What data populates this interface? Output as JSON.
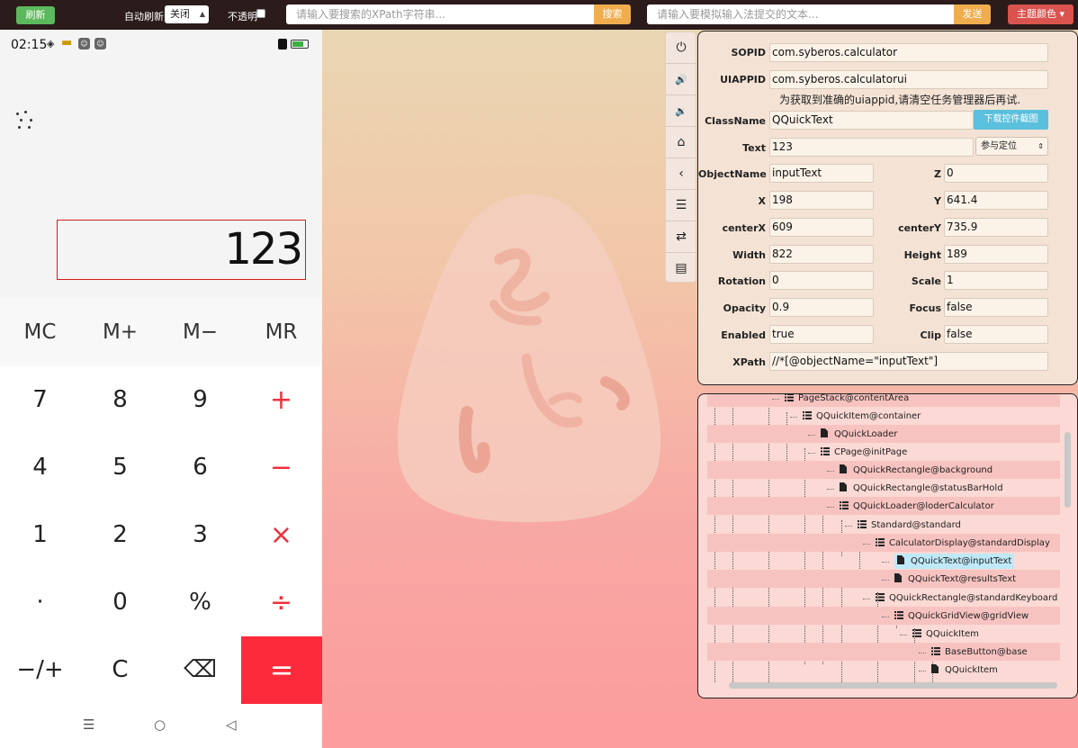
{
  "toolbar": {
    "refresh_label": "刷新",
    "auto_refresh_label": "自动刷新:",
    "auto_refresh_value": "关闭",
    "opaque_label": "不透明",
    "xpath_placeholder": "请输入要搜索的XPath字符串...",
    "search_label": "搜索",
    "input_placeholder": "请输入要模拟输入法提交的文本...",
    "send_label": "发送",
    "theme_label": "主题颜色 ▾"
  },
  "phone": {
    "time": "02:15",
    "display_value": "123",
    "memory_keys": [
      "MC",
      "M+",
      "M−",
      "MR"
    ],
    "keys": [
      [
        "7",
        "8",
        "9",
        "+"
      ],
      [
        "4",
        "5",
        "6",
        "−"
      ],
      [
        "1",
        "2",
        "3",
        "×"
      ],
      [
        "·",
        "0",
        "%",
        "÷"
      ],
      [
        "−/+",
        "C",
        "⌫",
        "="
      ]
    ],
    "nav": [
      "☰",
      "○",
      "◁"
    ]
  },
  "props": {
    "sopid_label": "SOPID",
    "sopid": "com.syberos.calculator",
    "uiappid_label": "UIAPPID",
    "uiappid": "com.syberos.calculatorui",
    "hint": "为获取到准确的uiappid,请清空任务管理器后再试.",
    "classname_label": "ClassName",
    "classname": "QQuickText",
    "download_label": "下载控件截图",
    "text_label": "Text",
    "text": "123",
    "locate_option": "参与定位",
    "objectname_label": "ObjectName",
    "objectname": "inputText",
    "z_label": "Z",
    "z": "0",
    "x_label": "X",
    "x": "198",
    "y_label": "Y",
    "y": "641.4",
    "centerx_label": "centerX",
    "centerx": "609",
    "centery_label": "centerY",
    "centery": "735.9",
    "width_label": "Width",
    "width": "822",
    "height_label": "Height",
    "height": "189",
    "rotation_label": "Rotation",
    "rotation": "0",
    "scale_label": "Scale",
    "scale": "1",
    "opacity_label": "Opacity",
    "opacity": "0.9",
    "focus_label": "Focus",
    "focus": "false",
    "enabled_label": "Enabled",
    "enabled": "true",
    "clip_label": "Clip",
    "clip": "false",
    "xpath_label": "XPath",
    "xpath": "//*[@objectName=\"inputText\"]"
  },
  "tree": {
    "nodes": [
      {
        "label": "PageStack@contentArea",
        "icon": "list-icon"
      },
      {
        "label": "QQuickItem@container",
        "icon": "list-icon"
      },
      {
        "label": "QQuickLoader",
        "icon": "file-icon"
      },
      {
        "label": "CPage@initPage",
        "icon": "list-icon"
      },
      {
        "label": "QQuickRectangle@background",
        "icon": "file-icon"
      },
      {
        "label": "QQuickRectangle@statusBarHold",
        "icon": "file-icon"
      },
      {
        "label": "QQuickLoader@loderCalculator",
        "icon": "list-icon"
      },
      {
        "label": "Standard@standard",
        "icon": "list-icon"
      },
      {
        "label": "CalculatorDisplay@standardDisplay",
        "icon": "list-icon"
      },
      {
        "label": "QQuickText@inputText",
        "icon": "file-icon",
        "selected": true
      },
      {
        "label": "QQuickText@resultsText",
        "icon": "file-icon"
      },
      {
        "label": "QQuickRectangle@standardKeyboard",
        "icon": "list-icon"
      },
      {
        "label": "QQuickGridView@gridView",
        "icon": "list-icon"
      },
      {
        "label": "QQuickItem",
        "icon": "list-icon"
      },
      {
        "label": "BaseButton@base",
        "icon": "list-icon"
      },
      {
        "label": "QQuickItem",
        "icon": "file-icon"
      }
    ]
  },
  "colors": {
    "accent_green": "#5cb85c",
    "accent_orange": "#f0ad4e",
    "accent_red": "#d9534f",
    "calc_equal": "#fc2a3b",
    "selection": "#bfe9f8"
  }
}
